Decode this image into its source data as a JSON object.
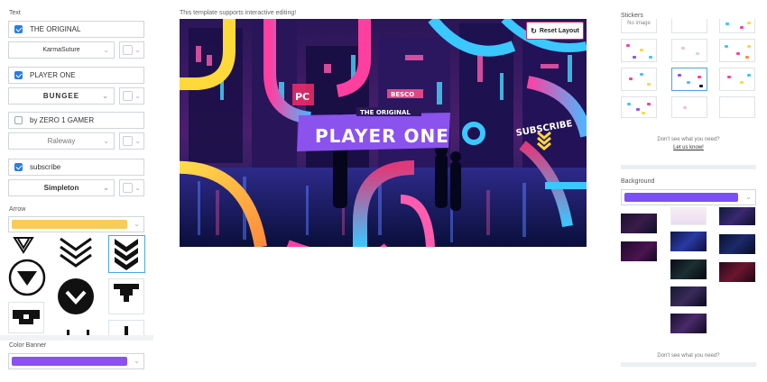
{
  "left": {
    "text_section_label": "Text",
    "text_items": [
      {
        "checked": true,
        "value": "THE ORIGINAL",
        "font": "KarmaSuture"
      },
      {
        "checked": true,
        "value": "PLAYER ONE",
        "font": "BUNGEE"
      },
      {
        "checked": false,
        "value": "by ZERO 1 GAMER",
        "font": "Raleway"
      },
      {
        "checked": true,
        "value": "subscribe",
        "font": "Simpleton"
      }
    ],
    "arrow_label": "Arrow",
    "arrow_color": "#f8cc59",
    "arrow_icons": [
      "chevron-down-thin-icon",
      "triple-chevron-outline-icon",
      "triple-chevron-solid-icon",
      "circle-triangle-down-icon",
      "circle-chevron-down-icon",
      "pixel-arrow-down-icon",
      "pixel-block-arrow-icon",
      "pixel-bar-icon",
      "pixel-stick-icon"
    ],
    "color_banner_label": "Color Banner",
    "banner_color": "#8b52ee"
  },
  "center": {
    "hint": "This template supports interactive editing!",
    "reset_label": "Reset Layout",
    "banner": {
      "small_text": "THE ORIGINAL",
      "main_text": "PLAYER ONE",
      "subscribe_text": "SUBSCRIBE",
      "sign_1": "PC",
      "sign_2": "BESCO"
    }
  },
  "right": {
    "stickers_label": "Stickers",
    "no_image_label": "No image",
    "help_question": "Don't see what you need?",
    "help_link": "Let us know!",
    "background_label": "Background",
    "background_color": "#7c4ef5",
    "help_question_2": "Don't see what you need?"
  },
  "colors": {
    "accent_blue": "#2a7de1",
    "reset_border": "#e0245e",
    "purple": "#8b52ee",
    "yellow": "#f8cc59"
  }
}
